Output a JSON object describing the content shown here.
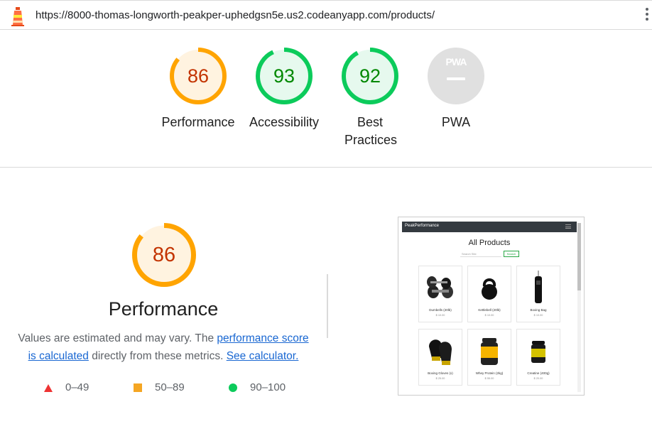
{
  "browser": {
    "url": "https://8000-thomas-longworth-peakper-uphedgsn5e.us2.codeanyapp.com/products/",
    "logo_icon": "lighthouse-icon",
    "menu_icon": "kebab-menu-icon"
  },
  "scores": [
    {
      "label": "Performance",
      "value": "86",
      "level": 0.86,
      "status": "average"
    },
    {
      "label": "Accessibility",
      "value": "93",
      "level": 0.93,
      "status": "pass"
    },
    {
      "label": "Best Practices",
      "value": "92",
      "level": 0.92,
      "status": "pass"
    },
    {
      "label": "PWA",
      "badge": "PWA",
      "status": "na"
    }
  ],
  "performance": {
    "score": "86",
    "level": 0.86,
    "title": "Performance",
    "desc_before": "Values are estimated and may vary. The ",
    "desc_link1": "performance score is calculated",
    "desc_middle": " directly from these metrics. ",
    "desc_link2": "See calculator."
  },
  "legend": [
    {
      "range": "0–49",
      "shape": "triangle",
      "color": "#ee3333"
    },
    {
      "range": "50–89",
      "shape": "square",
      "color": "#f5a623"
    },
    {
      "range": "90–100",
      "shape": "circle",
      "color": "#0ccb5b"
    }
  ],
  "colors": {
    "average": "#ffa400",
    "average_text": "#c33300",
    "average_bg": "#fff3e0",
    "pass": "#0ccb5b",
    "pass_text": "#008800",
    "pass_bg": "#e6f9ee",
    "na_bg": "#e0e0e0"
  },
  "screenshot": {
    "brand": "PeakPerformance",
    "heading": "All Products",
    "search_placeholder": "Search Site",
    "search_button": "Search",
    "products": [
      {
        "name": "Dumbells (20lb)",
        "price": "$ 10.00",
        "icon": "dumbbells-image"
      },
      {
        "name": "Kettlebell (20lb)",
        "price": "$ 10.00",
        "icon": "kettlebell-image"
      },
      {
        "name": "Boxing Bag",
        "price": "$ 10.00",
        "icon": "punching-bag-image"
      },
      {
        "name": "Boxing Gloves (x)",
        "price": "$ 25.00",
        "icon": "boxing-gloves-image"
      },
      {
        "name": "Whey Protein (2kg)",
        "price": "$ 55.00",
        "icon": "protein-tub-image"
      },
      {
        "name": "Creatine (400g)",
        "price": "$ 20.00",
        "icon": "creatine-tub-image"
      }
    ]
  }
}
